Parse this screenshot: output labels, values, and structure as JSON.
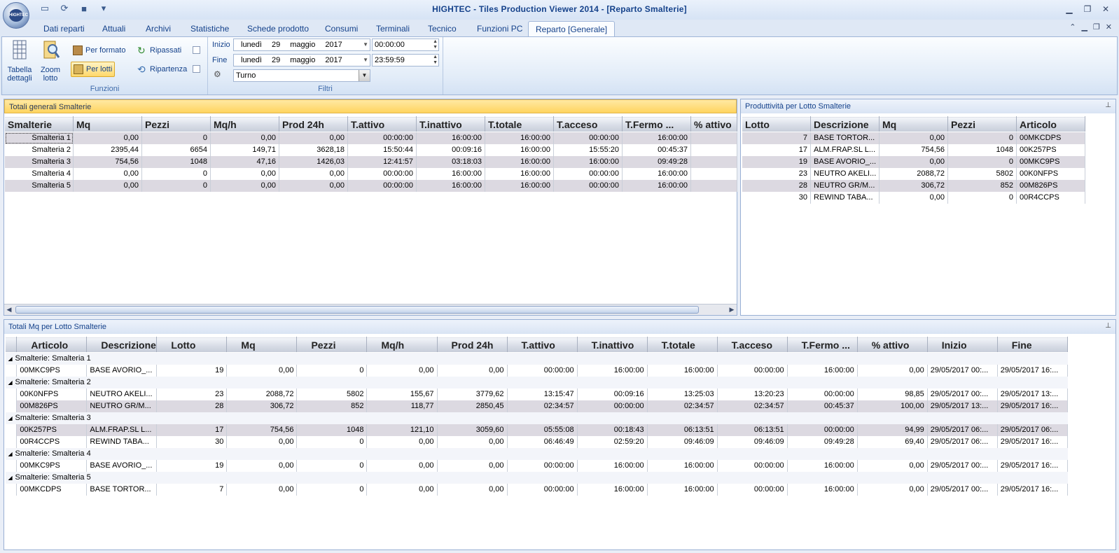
{
  "app": {
    "title": "HIGHTEC - Tiles Production Viewer 2014 - [Reparto Smalterie]",
    "orb_label": "HIGHTEC"
  },
  "qat": {
    "icons": [
      "new-icon",
      "refresh-icon",
      "save-icon",
      "customize-icon"
    ]
  },
  "tabs": [
    "Dati reparti",
    "Attuali",
    "Archivi",
    "Statistiche",
    "Schede prodotto",
    "Consumi",
    "Terminali",
    "Tecnico",
    "Funzioni PC",
    "Reparto [Generale]"
  ],
  "ribbon": {
    "funzioni": {
      "label": "Funzioni",
      "tabella": "Tabella dettagli",
      "zoom": "Zoom lotto",
      "per_formato": "Per formato",
      "per_lotti": "Per lotti",
      "ripassati": "Ripassati",
      "ripartenza": "Ripartenza"
    },
    "filtri": {
      "label": "Filtri",
      "inizio_label": "Inizio",
      "fine_label": "Fine",
      "inizio": {
        "day": "lunedì",
        "num": "29",
        "month": "maggio",
        "year": "2017",
        "time": "00:00:00"
      },
      "fine": {
        "day": "lunedì",
        "num": "29",
        "month": "maggio",
        "year": "2017",
        "time": "23:59:59"
      },
      "turno": "Turno"
    }
  },
  "totali": {
    "title": "Totali generali Smalterie",
    "columns": [
      "Smalterie",
      "Mq",
      "Pezzi",
      "Mq/h",
      "Prod 24h",
      "T.attivo",
      "T.inattivo",
      "T.totale",
      "T.acceso",
      "T.Fermo ...",
      "% attivo"
    ],
    "rows": [
      [
        "Smalteria 1",
        "0,00",
        "0",
        "0,00",
        "0,00",
        "00:00:00",
        "16:00:00",
        "16:00:00",
        "00:00:00",
        "16:00:00",
        ""
      ],
      [
        "Smalteria 2",
        "2395,44",
        "6654",
        "149,71",
        "3628,18",
        "15:50:44",
        "00:09:16",
        "16:00:00",
        "15:55:20",
        "00:45:37",
        ""
      ],
      [
        "Smalteria 3",
        "754,56",
        "1048",
        "47,16",
        "1426,03",
        "12:41:57",
        "03:18:03",
        "16:00:00",
        "16:00:00",
        "09:49:28",
        ""
      ],
      [
        "Smalteria 4",
        "0,00",
        "0",
        "0,00",
        "0,00",
        "00:00:00",
        "16:00:00",
        "16:00:00",
        "00:00:00",
        "16:00:00",
        ""
      ],
      [
        "Smalteria 5",
        "0,00",
        "0",
        "0,00",
        "0,00",
        "00:00:00",
        "16:00:00",
        "16:00:00",
        "00:00:00",
        "16:00:00",
        ""
      ]
    ]
  },
  "produttivita": {
    "title": "Produttività per Lotto Smalterie",
    "columns": [
      "Lotto",
      "Descrizione",
      "Mq",
      "Pezzi",
      "Articolo"
    ],
    "rows": [
      [
        "7",
        "BASE TORTOR...",
        "0,00",
        "0",
        "00MKCDPS"
      ],
      [
        "17",
        "ALM.FRAP.SL L...",
        "754,56",
        "1048",
        "00K257PS"
      ],
      [
        "19",
        "BASE AVORIO_...",
        "0,00",
        "0",
        "00MKC9PS"
      ],
      [
        "23",
        "NEUTRO AKELI...",
        "2088,72",
        "5802",
        "00K0NFPS"
      ],
      [
        "28",
        "NEUTRO GR/M...",
        "306,72",
        "852",
        "00M826PS"
      ],
      [
        "30",
        "REWIND TABA...",
        "0,00",
        "0",
        "00R4CCPS"
      ]
    ]
  },
  "totali_mq": {
    "title": "Totali Mq per Lotto Smalterie",
    "columns": [
      "Articolo",
      "Descrizione",
      "Lotto",
      "Mq",
      "Pezzi",
      "Mq/h",
      "Prod 24h",
      "T.attivo",
      "T.inattivo",
      "T.totale",
      "T.acceso",
      "T.Fermo ...",
      "% attivo",
      "Inizio",
      "Fine"
    ],
    "groups": [
      {
        "label": "Smalterie:  Smalteria 1",
        "rows": [
          [
            "00MKC9PS",
            "BASE AVORIO_...",
            "19",
            "0,00",
            "0",
            "0,00",
            "0,00",
            "00:00:00",
            "16:00:00",
            "16:00:00",
            "00:00:00",
            "16:00:00",
            "0,00",
            "29/05/2017 00:...",
            "29/05/2017 16:..."
          ]
        ]
      },
      {
        "label": "Smalterie:  Smalteria 2",
        "rows": [
          [
            "00K0NFPS",
            "NEUTRO AKELI...",
            "23",
            "2088,72",
            "5802",
            "155,67",
            "3779,62",
            "13:15:47",
            "00:09:16",
            "13:25:03",
            "13:20:23",
            "00:00:00",
            "98,85",
            "29/05/2017 00:...",
            "29/05/2017 13:..."
          ],
          [
            "00M826PS",
            "NEUTRO GR/M...",
            "28",
            "306,72",
            "852",
            "118,77",
            "2850,45",
            "02:34:57",
            "00:00:00",
            "02:34:57",
            "02:34:57",
            "00:45:37",
            "100,00",
            "29/05/2017 13:...",
            "29/05/2017 16:..."
          ]
        ]
      },
      {
        "label": "Smalterie:  Smalteria 3",
        "rows": [
          [
            "00K257PS",
            "ALM.FRAP.SL L...",
            "17",
            "754,56",
            "1048",
            "121,10",
            "3059,60",
            "05:55:08",
            "00:18:43",
            "06:13:51",
            "06:13:51",
            "00:00:00",
            "94,99",
            "29/05/2017 06:...",
            "29/05/2017 06:..."
          ],
          [
            "00R4CCPS",
            "REWIND TABA...",
            "30",
            "0,00",
            "0",
            "0,00",
            "0,00",
            "06:46:49",
            "02:59:20",
            "09:46:09",
            "09:46:09",
            "09:49:28",
            "69,40",
            "29/05/2017 06:...",
            "29/05/2017 16:..."
          ]
        ]
      },
      {
        "label": "Smalterie:  Smalteria 4",
        "rows": [
          [
            "00MKC9PS",
            "BASE AVORIO_...",
            "19",
            "0,00",
            "0",
            "0,00",
            "0,00",
            "00:00:00",
            "16:00:00",
            "16:00:00",
            "00:00:00",
            "16:00:00",
            "0,00",
            "29/05/2017 00:...",
            "29/05/2017 16:..."
          ]
        ]
      },
      {
        "label": "Smalterie:  Smalteria 5",
        "rows": [
          [
            "00MKCDPS",
            "BASE TORTOR...",
            "7",
            "0,00",
            "0",
            "0,00",
            "0,00",
            "00:00:00",
            "16:00:00",
            "16:00:00",
            "00:00:00",
            "16:00:00",
            "0,00",
            "29/05/2017 00:...",
            "29/05/2017 16:..."
          ]
        ]
      }
    ]
  }
}
